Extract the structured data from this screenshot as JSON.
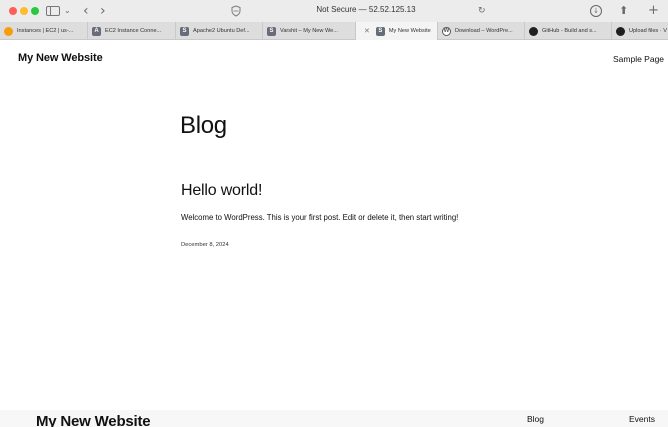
{
  "browser": {
    "address_text": "Not Secure — 52.52.125.13",
    "icons": [
      "sidebar-icon",
      "chevron-down-icon",
      "back-arrow-icon",
      "forward-arrow-icon",
      "shield-icon",
      "reload-icon",
      "download-icon",
      "share-icon",
      "new-tab-icon"
    ],
    "tabs": [
      {
        "label": "Instances | EC2 | us-...",
        "favicon": "aws-icon"
      },
      {
        "label": "EC2 Instance Conne...",
        "favicon": "aws-icon"
      },
      {
        "label": "Apache2 Ubuntu Def...",
        "favicon": "server-icon"
      },
      {
        "label": "Varshit – My New We...",
        "favicon": "server-icon"
      },
      {
        "label": "My New Website",
        "favicon": "server-icon",
        "active": true
      },
      {
        "label": "Download – WordPre...",
        "favicon": "wordpress-icon"
      },
      {
        "label": "GitHub - Build and s...",
        "favicon": "github-icon"
      },
      {
        "label": "Upload files · V",
        "favicon": "github-icon"
      }
    ]
  },
  "site": {
    "title": "My New Website",
    "nav": [
      "Sample Page"
    ]
  },
  "main": {
    "page_title": "Blog",
    "posts": [
      {
        "title": "Hello world!",
        "excerpt": "Welcome to WordPress. This is your first post. Edit or delete it, then start writing!",
        "date": "December 8, 2024"
      }
    ]
  },
  "footer": {
    "title": "My New Website",
    "links": [
      "Blog",
      "Events"
    ]
  },
  "colors": {
    "close_red": "#ff5f57",
    "minimize_yellow": "#febc2e",
    "zoom_green": "#28c840",
    "text": "#111111",
    "background": "#ffffff"
  }
}
